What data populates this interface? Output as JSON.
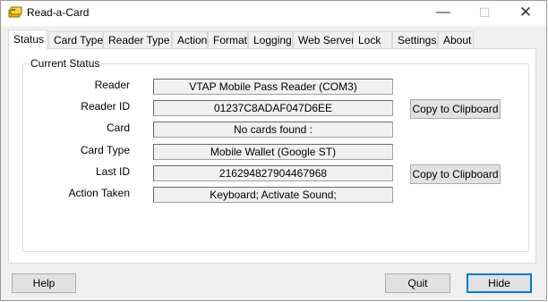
{
  "window": {
    "title": "Read-a-Card"
  },
  "tabs": [
    "Status",
    "Card Type",
    "Reader Type",
    "Action",
    "Format",
    "Logging",
    "Web Server",
    "Lock",
    "Settings",
    "About"
  ],
  "group": {
    "label": "Current Status"
  },
  "fields": {
    "reader": {
      "label": "Reader",
      "value": "VTAP Mobile Pass Reader (COM3)"
    },
    "reader_id": {
      "label": "Reader ID",
      "value": "01237C8ADAF047D6EE"
    },
    "card": {
      "label": "Card",
      "value": "No cards found :"
    },
    "card_type": {
      "label": "Card Type",
      "value": "Mobile Wallet (Google ST)"
    },
    "last_id": {
      "label": "Last ID",
      "value": "216294827904467968"
    },
    "action_taken": {
      "label": "Action Taken",
      "value": "Keyboard; Activate Sound;"
    }
  },
  "buttons": {
    "copy_reader_id": "Copy to Clipboard",
    "copy_last_id": "Copy to Clipboard",
    "help": "Help",
    "quit": "Quit",
    "hide": "Hide"
  },
  "colors": {
    "accent": "#0078d7",
    "icon": "#e8b400"
  },
  "icons": {
    "app": "card-reader-icon",
    "minimize": "minimize-icon",
    "maximize": "maximize-icon",
    "close": "close-icon"
  }
}
